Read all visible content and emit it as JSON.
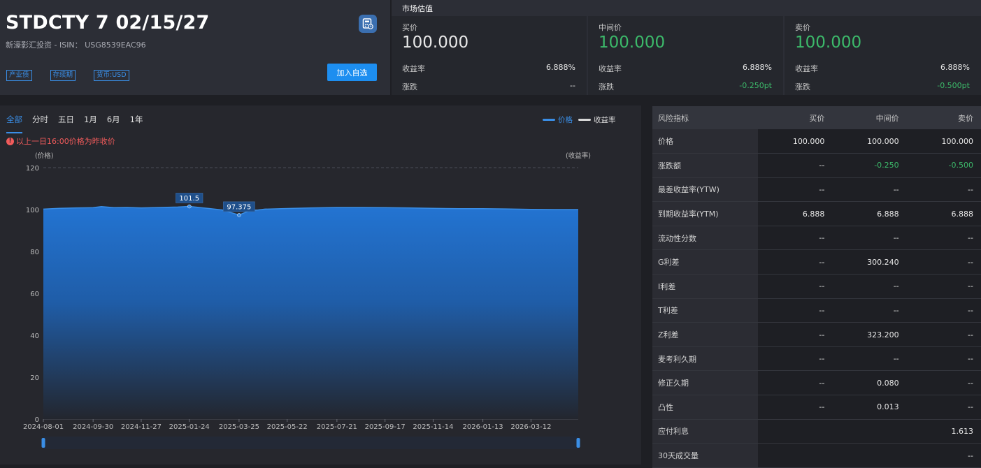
{
  "bond": {
    "name": "STDCTY 7 02/15/27",
    "issuer_line": "新濠影汇投资 - ISIN： USG8539EAC96",
    "tags": [
      "产业债",
      "存续期",
      "货币:USD"
    ],
    "add_button": "加入自选",
    "calc_icon": "calculator-icon"
  },
  "market": {
    "title": "市场估值",
    "columns": [
      {
        "label": "买价",
        "price": "100.000",
        "yield_label": "收益率",
        "yield": "6.888%",
        "change_label": "涨跌",
        "change": "--"
      },
      {
        "label": "中间价",
        "price": "100.000",
        "yield_label": "收益率",
        "yield": "6.888%",
        "change_label": "涨跌",
        "change": "-0.250pt"
      },
      {
        "label": "卖价",
        "price": "100.000",
        "yield_label": "收益率",
        "yield": "6.888%",
        "change_label": "涨跌",
        "change": "-0.500pt"
      }
    ],
    "colors": {
      "green": "#3cb96a"
    }
  },
  "chart_panel": {
    "tabs": [
      "全部",
      "分时",
      "五日",
      "1月",
      "6月",
      "1年"
    ],
    "active_tab": "全部",
    "notice": "以上一日16:00价格为昨收价",
    "notice_icon": "alert-icon"
  },
  "chart_data": {
    "type": "area",
    "series": [
      {
        "name": "价格",
        "color": "#3a8ee6"
      },
      {
        "name": "收益率",
        "color": "#d8d8d8"
      }
    ],
    "left_axis_label": "(价格)",
    "right_axis_label": "(收益率)",
    "ylim": [
      0,
      120
    ],
    "yticks": [
      0,
      20,
      40,
      60,
      80,
      100,
      120
    ],
    "grid": true,
    "x_tick_labels": [
      "2024-08-01",
      "2024-09-30",
      "2024-11-27",
      "2025-01-24",
      "2025-03-25",
      "2025-05-22",
      "2025-07-21",
      "2025-09-17",
      "2025-11-14",
      "2026-01-13",
      "2026-03-12"
    ],
    "x_range": [
      "2024-08-01",
      "2026-05-08"
    ],
    "price_points": [
      [
        "2024-08-01",
        100.2
      ],
      [
        "2024-08-20",
        100.6
      ],
      [
        "2024-09-10",
        100.8
      ],
      [
        "2024-09-30",
        100.9
      ],
      [
        "2024-10-10",
        101.4
      ],
      [
        "2024-10-25",
        100.9
      ],
      [
        "2024-11-10",
        101.0
      ],
      [
        "2024-11-27",
        100.8
      ],
      [
        "2024-12-20",
        101.0
      ],
      [
        "2025-01-10",
        101.2
      ],
      [
        "2025-01-24",
        101.5
      ],
      [
        "2025-02-15",
        100.6
      ],
      [
        "2025-03-05",
        99.8
      ],
      [
        "2025-03-25",
        97.4
      ],
      [
        "2025-04-05",
        99.2
      ],
      [
        "2025-04-25",
        100.2
      ],
      [
        "2025-05-22",
        100.5
      ],
      [
        "2025-06-20",
        100.8
      ],
      [
        "2025-07-21",
        101.0
      ],
      [
        "2025-08-20",
        101.0
      ],
      [
        "2025-09-17",
        100.9
      ],
      [
        "2025-10-15",
        100.8
      ],
      [
        "2025-11-14",
        100.6
      ],
      [
        "2025-12-15",
        100.4
      ],
      [
        "2026-01-13",
        100.4
      ],
      [
        "2026-02-10",
        100.3
      ],
      [
        "2026-03-12",
        100.1
      ],
      [
        "2026-04-10",
        100.0
      ],
      [
        "2026-05-08",
        100.0
      ]
    ],
    "annotations": [
      {
        "date": "2025-01-24",
        "value": 101.5,
        "label": "101.5"
      },
      {
        "date": "2025-03-25",
        "value": 97.375,
        "label": "97.375"
      }
    ]
  },
  "risk_table": {
    "headers": [
      "风险指标",
      "买价",
      "中间价",
      "卖价"
    ],
    "rows": [
      {
        "name": "价格",
        "bid": "100.000",
        "mid": "100.000",
        "ask": "100.000"
      },
      {
        "name": "涨跌额",
        "bid": "--",
        "mid": "-0.250",
        "ask": "-0.500",
        "green": true
      },
      {
        "name": "最差收益率(YTW)",
        "bid": "--",
        "mid": "--",
        "ask": "--"
      },
      {
        "name": "到期收益率(YTM)",
        "bid": "6.888",
        "mid": "6.888",
        "ask": "6.888"
      },
      {
        "name": "流动性分数",
        "bid": "--",
        "mid": "--",
        "ask": "--"
      },
      {
        "name": "G利差",
        "bid": "--",
        "mid": "300.240",
        "ask": "--"
      },
      {
        "name": "I利差",
        "bid": "--",
        "mid": "--",
        "ask": "--"
      },
      {
        "name": "T利差",
        "bid": "--",
        "mid": "--",
        "ask": "--"
      },
      {
        "name": "Z利差",
        "bid": "--",
        "mid": "323.200",
        "ask": "--"
      },
      {
        "name": "麦考利久期",
        "bid": "--",
        "mid": "--",
        "ask": "--"
      },
      {
        "name": "修正久期",
        "bid": "--",
        "mid": "0.080",
        "ask": "--"
      },
      {
        "name": "凸性",
        "bid": "--",
        "mid": "0.013",
        "ask": "--"
      },
      {
        "name": "应付利息",
        "bid": "",
        "mid": "",
        "ask": "1.613"
      },
      {
        "name": "30天成交量",
        "bid": "",
        "mid": "",
        "ask": "--"
      }
    ]
  }
}
